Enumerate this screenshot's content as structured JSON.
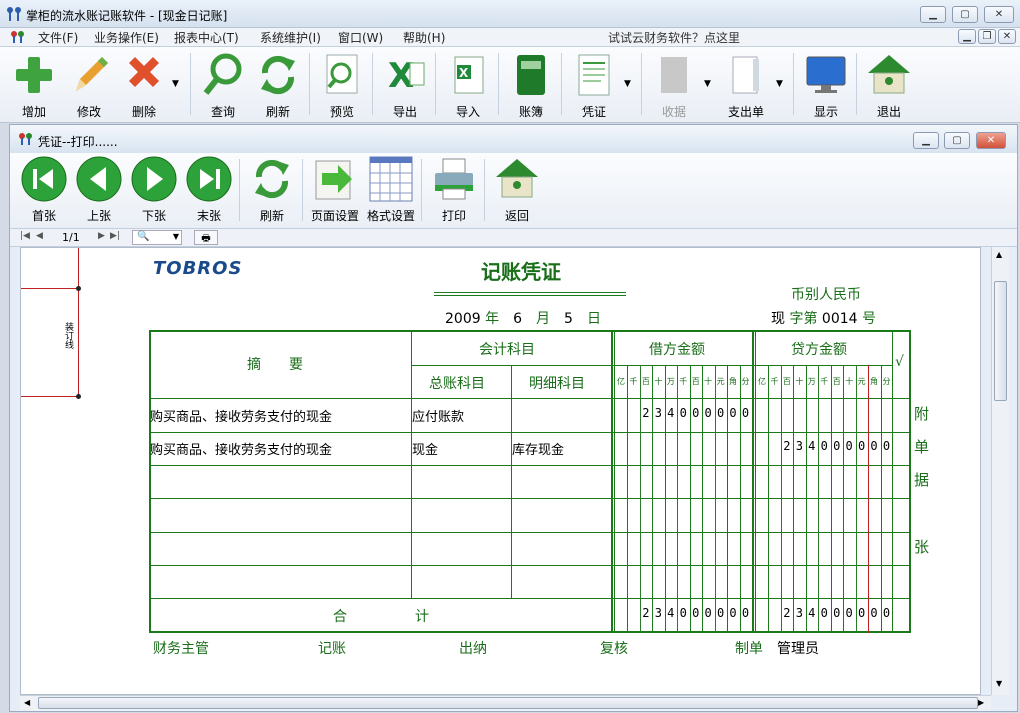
{
  "app": {
    "title": "掌柜的流水账记账软件 - [现金日记账]"
  },
  "menu": {
    "items": [
      "文件(F)",
      "业务操作(E)",
      "报表中心(T)",
      "系统维护(I)",
      "窗口(W)",
      "帮助(H)"
    ],
    "promo": "试试云财务软件？点这里"
  },
  "toolbar": {
    "items": [
      "增加",
      "修改",
      "删除",
      "查询",
      "刷新",
      "预览",
      "导出",
      "导入",
      "账簿",
      "凭证",
      "收据",
      "支出单",
      "显示",
      "退出"
    ]
  },
  "child": {
    "title": "凭证--打印......"
  },
  "preview_toolbar": {
    "items": [
      "首张",
      "上张",
      "下张",
      "末张",
      "刷新",
      "页面设置",
      "格式设置",
      "打印",
      "返回"
    ]
  },
  "nav": {
    "page": "1/1"
  },
  "voucher": {
    "logo": "TOBROS",
    "title": "记账凭证",
    "currency_label": "币别",
    "currency": "人民币",
    "year": "2009",
    "year_label": "年",
    "month": "6",
    "month_label": "月",
    "day": "5",
    "day_label": "日",
    "word_prefix": "现",
    "word_label": "字第",
    "number": "0014",
    "number_label": "号",
    "binding": "装订线",
    "headers": {
      "summary": "摘　　要",
      "account": "会计科目",
      "general": "总账科目",
      "detail": "明细科目",
      "debit": "借方金额",
      "credit": "贷方金额",
      "check": "√"
    },
    "units": [
      "亿",
      "千",
      "百",
      "十",
      "万",
      "千",
      "百",
      "十",
      "元",
      "角",
      "分"
    ],
    "rows": [
      {
        "summary": "购买商品、接收劳务支付的现金",
        "general": "应付账款",
        "detail": "",
        "debit": "234000000",
        "credit": ""
      },
      {
        "summary": "购买商品、接收劳务支付的现金",
        "general": "现金",
        "detail": "库存现金",
        "debit": "",
        "credit": "234000000"
      }
    ],
    "total_label_1": "合",
    "total_label_2": "计",
    "total_debit": "234000000",
    "total_credit": "234000000",
    "side_labels": [
      "附",
      "单",
      "据",
      "张"
    ],
    "footer": {
      "manager": "财务主管",
      "bookkeeper": "记账",
      "cashier": "出纳",
      "reviewer": "复核",
      "maker_label": "制单",
      "maker": "管理员"
    }
  }
}
